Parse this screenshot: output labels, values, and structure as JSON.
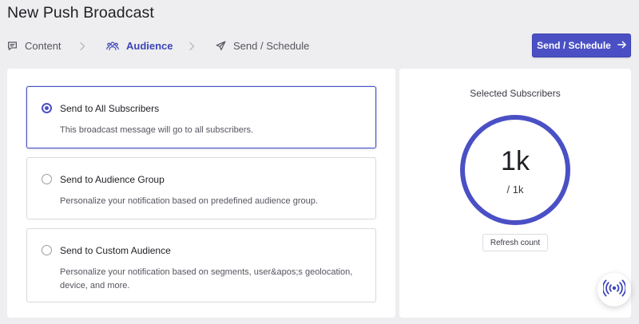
{
  "page": {
    "title": "New Push Broadcast"
  },
  "steps": [
    {
      "label": "Content",
      "icon": "message-square-icon",
      "state": "default"
    },
    {
      "label": "Audience",
      "icon": "users-icon",
      "state": "active"
    },
    {
      "label": "Send / Schedule",
      "icon": "paper-plane-icon",
      "state": "default"
    }
  ],
  "header": {
    "primary_button_label": "Send / Schedule",
    "primary_button_icon": "arrow-right-icon"
  },
  "audience_options": [
    {
      "title": "Send to All Subscribers",
      "description": "This broadcast message will go to all subscribers.",
      "selected": true
    },
    {
      "title": "Send to Audience Group",
      "description": "Personalize your notification based on predefined audience group.",
      "selected": false
    },
    {
      "title": "Send to Custom Audience",
      "description": "Personalize your notification based on segments, user&apos;s geolocation, device, and more.",
      "selected": false
    }
  ],
  "subscribers": {
    "title": "Selected Subscribers",
    "count": "1k",
    "total": "/ 1k",
    "refresh_label": "Refresh count"
  },
  "floating": {
    "icon": "broadcast-icon"
  },
  "colors": {
    "accent": "#4a50c4",
    "background": "#eeeef0",
    "panel": "#ffffff"
  }
}
